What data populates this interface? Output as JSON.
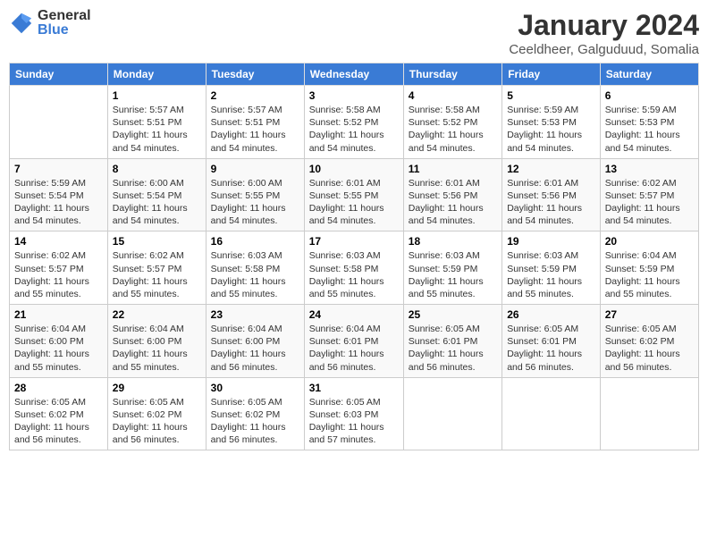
{
  "logo": {
    "general": "General",
    "blue": "Blue"
  },
  "title": "January 2024",
  "subtitle": "Ceeldheer, Galguduud, Somalia",
  "days_of_week": [
    "Sunday",
    "Monday",
    "Tuesday",
    "Wednesday",
    "Thursday",
    "Friday",
    "Saturday"
  ],
  "weeks": [
    [
      {
        "day": "",
        "sunrise": "",
        "sunset": "",
        "daylight": ""
      },
      {
        "day": "1",
        "sunrise": "5:57 AM",
        "sunset": "5:51 PM",
        "daylight": "11 hours and 54 minutes."
      },
      {
        "day": "2",
        "sunrise": "5:57 AM",
        "sunset": "5:51 PM",
        "daylight": "11 hours and 54 minutes."
      },
      {
        "day": "3",
        "sunrise": "5:58 AM",
        "sunset": "5:52 PM",
        "daylight": "11 hours and 54 minutes."
      },
      {
        "day": "4",
        "sunrise": "5:58 AM",
        "sunset": "5:52 PM",
        "daylight": "11 hours and 54 minutes."
      },
      {
        "day": "5",
        "sunrise": "5:59 AM",
        "sunset": "5:53 PM",
        "daylight": "11 hours and 54 minutes."
      },
      {
        "day": "6",
        "sunrise": "5:59 AM",
        "sunset": "5:53 PM",
        "daylight": "11 hours and 54 minutes."
      }
    ],
    [
      {
        "day": "7",
        "sunrise": "5:59 AM",
        "sunset": "5:54 PM",
        "daylight": "11 hours and 54 minutes."
      },
      {
        "day": "8",
        "sunrise": "6:00 AM",
        "sunset": "5:54 PM",
        "daylight": "11 hours and 54 minutes."
      },
      {
        "day": "9",
        "sunrise": "6:00 AM",
        "sunset": "5:55 PM",
        "daylight": "11 hours and 54 minutes."
      },
      {
        "day": "10",
        "sunrise": "6:01 AM",
        "sunset": "5:55 PM",
        "daylight": "11 hours and 54 minutes."
      },
      {
        "day": "11",
        "sunrise": "6:01 AM",
        "sunset": "5:56 PM",
        "daylight": "11 hours and 54 minutes."
      },
      {
        "day": "12",
        "sunrise": "6:01 AM",
        "sunset": "5:56 PM",
        "daylight": "11 hours and 54 minutes."
      },
      {
        "day": "13",
        "sunrise": "6:02 AM",
        "sunset": "5:57 PM",
        "daylight": "11 hours and 54 minutes."
      }
    ],
    [
      {
        "day": "14",
        "sunrise": "6:02 AM",
        "sunset": "5:57 PM",
        "daylight": "11 hours and 55 minutes."
      },
      {
        "day": "15",
        "sunrise": "6:02 AM",
        "sunset": "5:57 PM",
        "daylight": "11 hours and 55 minutes."
      },
      {
        "day": "16",
        "sunrise": "6:03 AM",
        "sunset": "5:58 PM",
        "daylight": "11 hours and 55 minutes."
      },
      {
        "day": "17",
        "sunrise": "6:03 AM",
        "sunset": "5:58 PM",
        "daylight": "11 hours and 55 minutes."
      },
      {
        "day": "18",
        "sunrise": "6:03 AM",
        "sunset": "5:59 PM",
        "daylight": "11 hours and 55 minutes."
      },
      {
        "day": "19",
        "sunrise": "6:03 AM",
        "sunset": "5:59 PM",
        "daylight": "11 hours and 55 minutes."
      },
      {
        "day": "20",
        "sunrise": "6:04 AM",
        "sunset": "5:59 PM",
        "daylight": "11 hours and 55 minutes."
      }
    ],
    [
      {
        "day": "21",
        "sunrise": "6:04 AM",
        "sunset": "6:00 PM",
        "daylight": "11 hours and 55 minutes."
      },
      {
        "day": "22",
        "sunrise": "6:04 AM",
        "sunset": "6:00 PM",
        "daylight": "11 hours and 55 minutes."
      },
      {
        "day": "23",
        "sunrise": "6:04 AM",
        "sunset": "6:00 PM",
        "daylight": "11 hours and 56 minutes."
      },
      {
        "day": "24",
        "sunrise": "6:04 AM",
        "sunset": "6:01 PM",
        "daylight": "11 hours and 56 minutes."
      },
      {
        "day": "25",
        "sunrise": "6:05 AM",
        "sunset": "6:01 PM",
        "daylight": "11 hours and 56 minutes."
      },
      {
        "day": "26",
        "sunrise": "6:05 AM",
        "sunset": "6:01 PM",
        "daylight": "11 hours and 56 minutes."
      },
      {
        "day": "27",
        "sunrise": "6:05 AM",
        "sunset": "6:02 PM",
        "daylight": "11 hours and 56 minutes."
      }
    ],
    [
      {
        "day": "28",
        "sunrise": "6:05 AM",
        "sunset": "6:02 PM",
        "daylight": "11 hours and 56 minutes."
      },
      {
        "day": "29",
        "sunrise": "6:05 AM",
        "sunset": "6:02 PM",
        "daylight": "11 hours and 56 minutes."
      },
      {
        "day": "30",
        "sunrise": "6:05 AM",
        "sunset": "6:02 PM",
        "daylight": "11 hours and 56 minutes."
      },
      {
        "day": "31",
        "sunrise": "6:05 AM",
        "sunset": "6:03 PM",
        "daylight": "11 hours and 57 minutes."
      },
      {
        "day": "",
        "sunrise": "",
        "sunset": "",
        "daylight": ""
      },
      {
        "day": "",
        "sunrise": "",
        "sunset": "",
        "daylight": ""
      },
      {
        "day": "",
        "sunrise": "",
        "sunset": "",
        "daylight": ""
      }
    ]
  ]
}
